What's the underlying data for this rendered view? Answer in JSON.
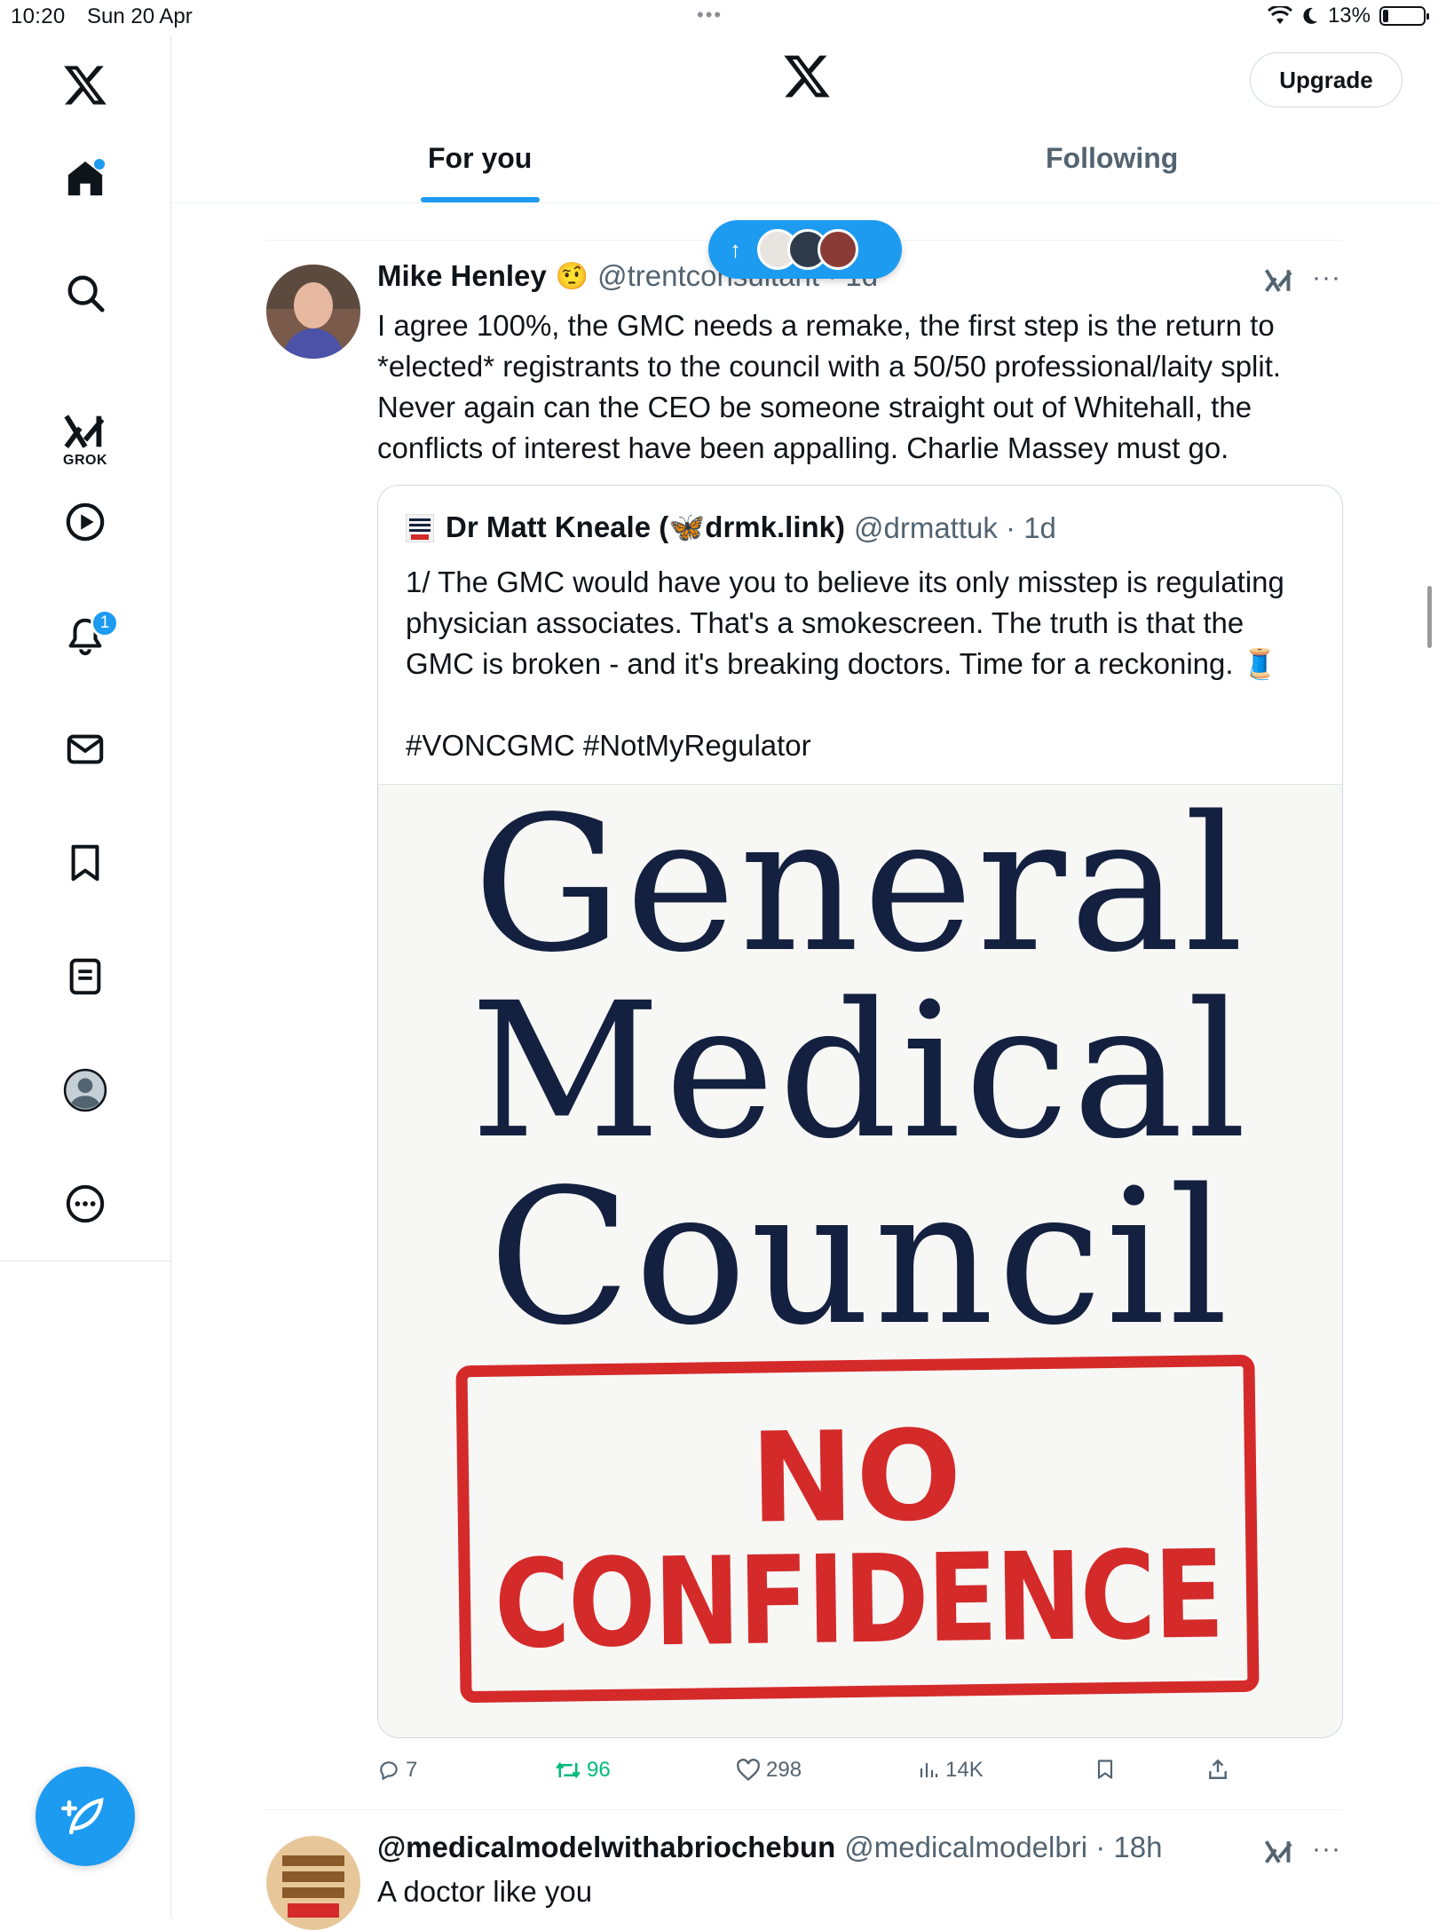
{
  "status_bar": {
    "time": "10:20",
    "date": "Sun 20 Apr",
    "battery_text": "13%",
    "battery_level": 0.13
  },
  "sidebar": {
    "grok_label": "GROK",
    "notifications_count": "1",
    "items": [
      {
        "name": "home",
        "icon": "home-icon"
      },
      {
        "name": "explore",
        "icon": "search-icon"
      },
      {
        "name": "grok",
        "icon": "grok-icon"
      },
      {
        "name": "video",
        "icon": "play-icon"
      },
      {
        "name": "notifications",
        "icon": "bell-icon"
      },
      {
        "name": "messages",
        "icon": "mail-icon"
      },
      {
        "name": "bookmarks",
        "icon": "bookmark-icon"
      },
      {
        "name": "lists",
        "icon": "list-icon"
      },
      {
        "name": "profile",
        "icon": "profile-icon"
      },
      {
        "name": "more",
        "icon": "more-icon"
      }
    ]
  },
  "header": {
    "upgrade_label": "Upgrade",
    "tabs": [
      {
        "label": "For you",
        "active": true
      },
      {
        "label": "Following",
        "active": false
      }
    ]
  },
  "colors": {
    "accent": "#1d9bf0",
    "text_primary": "#0f1419",
    "text_secondary": "#536471",
    "retweet_green": "#00ba7c",
    "stamp_red": "#d42a2a",
    "gmc_navy": "#14203f"
  },
  "tweet": {
    "author_name": "Mike Henley",
    "author_emoji": "🤨",
    "author_handle": "@trentconsultant · 1d",
    "body": "I agree 100%, the GMC needs a remake, the first step is the return to *elected* registrants to the council with a 50/50 professional/laity split. Never again can the CEO be someone straight out of Whitehall, the conflicts of interest have been appalling. Charlie Massey must go.",
    "quote": {
      "author_name": "Dr Matt Kneale (🦋drmk.link)",
      "author_handle": "@drmattuk · 1d",
      "text": "1/ The GMC would have you to believe its only misstep is regulating physician associates. That's a smokescreen. The truth is that the GMC is broken - and it's breaking doctors. Time for a reckoning. 🧵",
      "hashtags": "#VONCGMC #NotMyRegulator",
      "image": {
        "line1": "General",
        "line2": "Medical",
        "line3": "Council",
        "stamp_line1": "NO",
        "stamp_line2": "CONFIDENCE"
      }
    },
    "actions": {
      "replies": "7",
      "reposts": "96",
      "likes": "298",
      "views": "14K"
    }
  },
  "next_tweet": {
    "author_name": "@medicalmodelwithabriochebun",
    "author_handle": "@medicalmodelbri · 18h",
    "body": "A doctor like you"
  }
}
